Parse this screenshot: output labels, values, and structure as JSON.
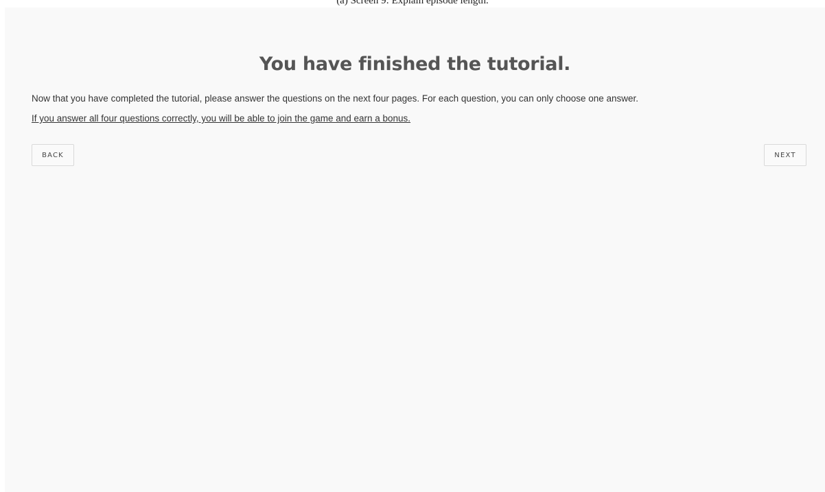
{
  "caption": "(a) Screen 9: Explain episode length.",
  "page": {
    "title": "You have finished the tutorial.",
    "intro": "Now that you have completed the tutorial, please answer the questions on the next four pages. For each question, you can only choose one answer.",
    "note": "If you answer all four questions correctly, you will be able to join the game and earn a bonus."
  },
  "nav": {
    "back_label": "BACK",
    "next_label": "NEXT"
  },
  "colors": {
    "background": "#f9f9f9",
    "title": "#555555",
    "text": "#333333",
    "button_border": "#d9d9d9"
  }
}
